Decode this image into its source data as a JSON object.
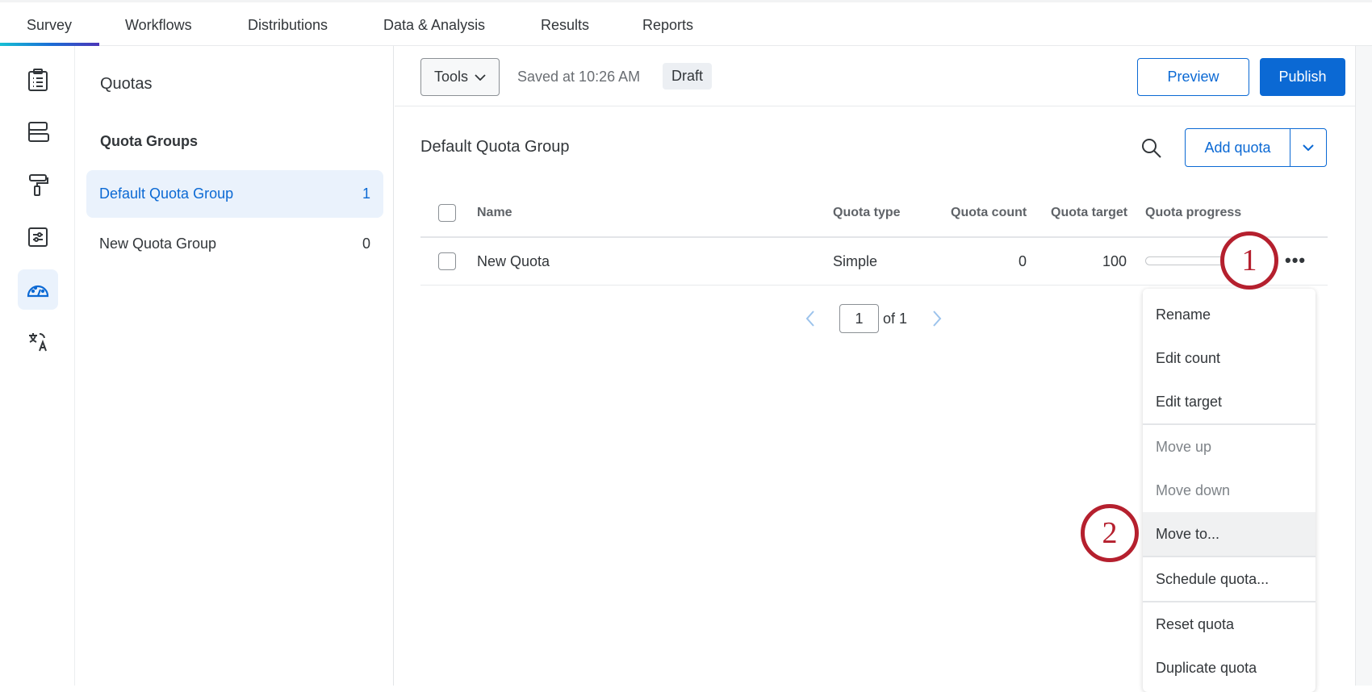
{
  "topnav": {
    "tabs": [
      "Survey",
      "Workflows",
      "Distributions",
      "Data & Analysis",
      "Results",
      "Reports"
    ],
    "active": "Survey"
  },
  "rail": {
    "icons": [
      "survey-clipboard-icon",
      "blocks-layout-icon",
      "look-and-feel-paint-roller-icon",
      "survey-options-sliders-icon",
      "quotas-gauge-icon",
      "translate-icon"
    ],
    "active": "quotas-gauge-icon"
  },
  "panel": {
    "title": "Quotas",
    "groups_heading": "Quota Groups",
    "groups": [
      {
        "name": "Default Quota Group",
        "count": "1"
      },
      {
        "name": "New Quota Group",
        "count": "0"
      }
    ]
  },
  "toolbar": {
    "tools_label": "Tools",
    "saved_text": "Saved at 10:26 AM",
    "status_badge": "Draft",
    "preview_label": "Preview",
    "publish_label": "Publish"
  },
  "main": {
    "group_title": "Default Quota Group",
    "add_quota_label": "Add quota",
    "columns": [
      "Name",
      "Quota type",
      "Quota count",
      "Quota target",
      "Quota progress"
    ],
    "rows": [
      {
        "name": "New Quota",
        "type": "Simple",
        "count": "0",
        "target": "100",
        "progress": 0
      }
    ],
    "pagination": {
      "page": "1",
      "of_label": "of 1"
    }
  },
  "menu": {
    "items": [
      "Rename",
      "Edit count",
      "Edit target",
      "Move up",
      "Move down",
      "Move to...",
      "Schedule quota...",
      "Reset quota",
      "Duplicate quota"
    ]
  },
  "annotations": [
    "1",
    "2"
  ],
  "colors": {
    "accent": "#0b69d4",
    "annotation": "#b5202e"
  }
}
